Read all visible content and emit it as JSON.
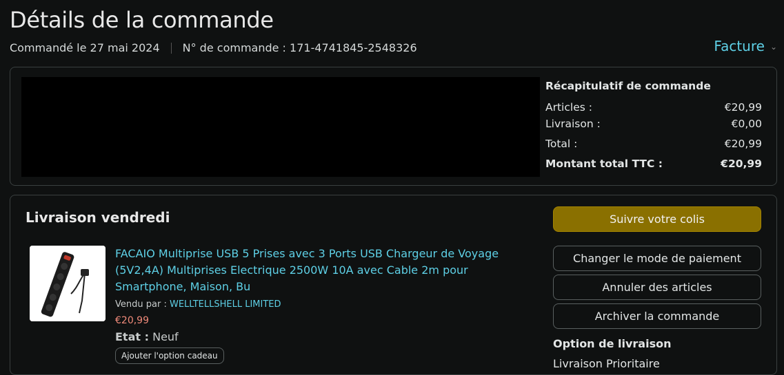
{
  "header": {
    "title": "Détails de la commande",
    "ordered_on": "Commandé le 27 mai 2024",
    "order_number": "N° de commande : 171-4741845-2548326",
    "invoice_label": "Facture"
  },
  "summary": {
    "title": "Récapitulatif de commande",
    "rows": [
      {
        "label": "Articles :",
        "value": "€20,99"
      },
      {
        "label": "Livraison :",
        "value": "€0,00"
      },
      {
        "label": "Total :",
        "value": "€20,99"
      },
      {
        "label": "Montant total TTC :",
        "value": "€20,99"
      }
    ]
  },
  "shipment": {
    "title": "Livraison vendredi",
    "product": {
      "name": "FACAIO Multiprise USB 5 Prises avec 3 Ports USB Chargeur de Voyage (5V2,4A) Multiprises Electrique 2500W 10A avec Cable 2m pour Smartphone, Maison, Bu",
      "sold_by_label": "Vendu par :",
      "seller": "WELLTELLSHELL LIMITED",
      "price": "€20,99",
      "condition_label": "Etat :",
      "condition": "Neuf",
      "gift_button": "Ajouter l'option cadeau"
    },
    "actions": {
      "track": "Suivre votre colis",
      "change_payment": "Changer le mode de paiement",
      "cancel": "Annuler des articles",
      "archive": "Archiver la commande"
    },
    "delivery_option_label": "Option de livraison",
    "delivery_option_value": "Livraison Prioritaire"
  },
  "colors": {
    "background": "#0f1111",
    "link": "#5ed0e6",
    "primary_button": "#8a7000",
    "price": "#f08a7a"
  }
}
